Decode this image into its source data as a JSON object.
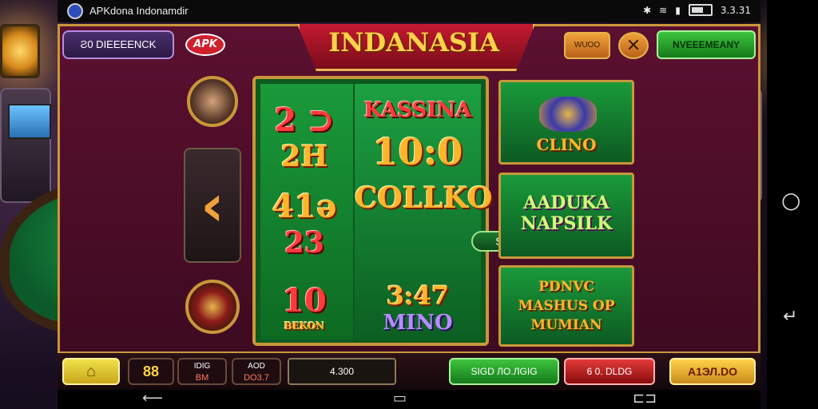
{
  "status_bar": {
    "app_title": "APKdona Indonamdir",
    "time": "3.3.31"
  },
  "header": {
    "left_pill": "Ƨ0 DIEEEENCK",
    "apk_badge": "APK",
    "title": "INDANASIA",
    "menu_button": "WUOO",
    "close_button": "✕",
    "right_pill": "NVEEEMEANY"
  },
  "slot": {
    "left_reel": [
      "2 ⊃",
      "2H",
      "41ə",
      "23",
      "10"
    ],
    "left_reel_caption": "BEKON",
    "right_reel": [
      "KASSINA",
      "10:0",
      "COLLKO"
    ],
    "pill": "SSINO",
    "bottom_num": "3:47",
    "bottom_word": "MINO"
  },
  "panels": [
    {
      "text": "CLINO"
    },
    {
      "text": "AADUKA\nNAPSILK"
    },
    {
      "text": "PDNVC\nMASHUS OP\nMUMIAN"
    }
  ],
  "bottom_bar": {
    "home_icon": "home-icon",
    "counter": "88",
    "stat1_label": "IDIG",
    "stat1_value": "BM",
    "stat2_label": "AOD",
    "stat2_value": "DO3.7",
    "field": "4.300",
    "green_button": "SIGD ЛО.ЛGIG",
    "red_button": "6 0. DLDG",
    "bet_button": "A1ЭЛ.DO"
  },
  "nav": {
    "back": "back-icon",
    "home": "home-circle-icon",
    "recents": "recents-icon"
  }
}
